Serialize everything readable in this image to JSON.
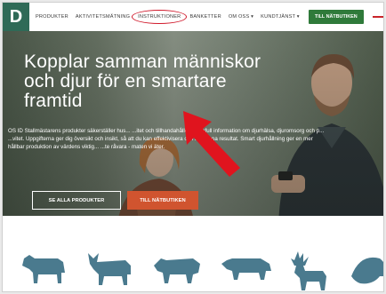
{
  "nav": {
    "logo": "D",
    "items": [
      "PRODUKTER",
      "AKTIVITETSMÄTNING",
      "INSTRUKTIONER",
      "BANKETTER",
      "OM OSS ▾",
      "KUNDTJÄNST ▾"
    ],
    "shop_button": "TILL NÄTBUTIKEN"
  },
  "hero": {
    "headline": "Kopplar samman människor och djur för en smartare framtid",
    "body": "OS ID Stallmästarens produkter säkerställer hus... ...itet och tillhandahåller värdefull information om djurhälsa, djuromsorg och p... ...vitet. Uppgifterna ger dig översikt och insikt, så att du kan effektivisera och för... ...na resultat. Smart djurhållning ger en mer hållbar produktion av värdens viktig... ...te råvara - maten vi äter.",
    "primary_button": "SE ALLA PRODUKTER",
    "secondary_button": "TILL NÄTBUTIKEN"
  },
  "animals": [
    "cow-icon",
    "cattle-icon",
    "sheep-icon",
    "pig-icon",
    "reindeer-icon",
    "fish-icon"
  ],
  "colors": {
    "brand_green": "#2f6a57",
    "shop_green": "#2f7a3a",
    "accent_orange": "#d0542f",
    "annotation_red": "#d0182a",
    "animal_blue": "#4a7a8e"
  }
}
